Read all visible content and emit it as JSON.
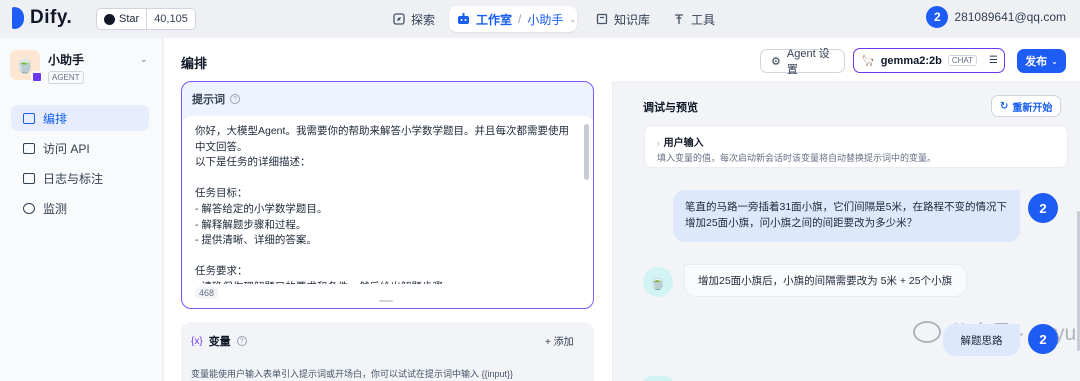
{
  "topbar": {
    "logo_text": "Dify.",
    "github_label": "Star",
    "github_count": "40,105",
    "nav_explore": "探索",
    "nav_studio": "工作室",
    "nav_app": "小助手",
    "nav_knowledge": "知识库",
    "nav_tools": "工具",
    "user_avatar_text": "2",
    "user_email": "281089641@qq.com"
  },
  "sidebar": {
    "app_name": "小助手",
    "app_type": "AGENT",
    "items": [
      {
        "label": "编排",
        "icon": "layout-icon",
        "active": true
      },
      {
        "label": "访问 API",
        "icon": "terminal-icon",
        "active": false
      },
      {
        "label": "日志与标注",
        "icon": "file-list-icon",
        "active": false
      },
      {
        "label": "监测",
        "icon": "monitor-icon",
        "active": false
      }
    ]
  },
  "header": {
    "title": "编排",
    "agent_settings_label": "Agent 设置",
    "model_name": "gemma2:2b",
    "model_mode": "CHAT",
    "publish_label": "发布"
  },
  "prompt": {
    "title": "提示词",
    "text": "你好，大模型Agent。我需要你的帮助来解答小学数学题目。并且每次都需要使用中文回答。\n以下是任务的详细描述：\n\n任务目标：\n- 解答给定的小学数学题目。\n- 解释解题步骤和过程。\n- 提供清晰、详细的答案。\n\n任务要求：\n- 请确保你理解题目的要求和条件，然后给出解题步骤。",
    "char_count": "468"
  },
  "variables": {
    "title": "变量",
    "add_label": "添加",
    "description": "变量能使用户输入表单引入提示词或开场白，你可以试试在提示词中输入 {{input}}"
  },
  "debug": {
    "title": "调试与预览",
    "restart_label": "重新开始",
    "user_input_title": "用户输入",
    "user_input_desc": "填入变量的值，每次启动新会话时该变量将自动替换提示词中的变量。",
    "messages": [
      {
        "role": "user",
        "avatar": "2",
        "text": "笔直的马路一旁插着31面小旗，它们间隔是5米，在路程不变的情况下增加25面小旗，问小旗之间的间距要改为多少米？"
      },
      {
        "role": "assistant",
        "text": "增加25面小旗后，小旗的间隔需要改为 5米 + 25个小旗"
      },
      {
        "role": "user",
        "avatar": "2",
        "text": "解题思路"
      }
    ],
    "watermark": "公众号 · dayuclub"
  },
  "colors": {
    "accent": "#1e5cf6",
    "prompt_border": "#7a5af8",
    "user_bubble": "#dde8fd"
  }
}
